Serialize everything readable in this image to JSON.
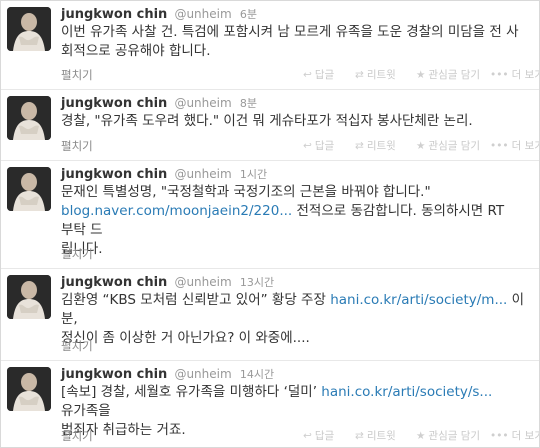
{
  "tweets": [
    {
      "name": "jungkwon chin",
      "handle": "@unheim",
      "time": "6분",
      "lines": [
        "이번 유가족 사찰 건. 특검에 포함시켜 남 모르게 유족을 도운 경찰의 미담을 전 사",
        "회적으로 공유해야 합니다."
      ],
      "expand": "펼치기"
    },
    {
      "name": "jungkwon chin",
      "handle": "@unheim",
      "time": "8분",
      "lines": [
        "경찰, \"유가족 도우려 했다.\" 이건 뭐 게슈타포가 적십자 봉사단체란 논리."
      ],
      "expand": "펼치기"
    },
    {
      "name": "jungkwon chin",
      "handle": "@unheim",
      "time": "1시간",
      "line1": "문재인 특별성명, \"국정철학과 국정기조의 근본을 바꿔야 합니다.\"",
      "link": "blog.naver.com/moonjaein2/220...",
      "line2_rest": " 전적으로 동감합니다. 동의하시면 RT 부탁 드",
      "line3": "립니다.",
      "expand": "펼치기"
    },
    {
      "name": "jungkwon chin",
      "handle": "@unheim",
      "time": "13시간",
      "line1_pre": "김환영 “KBS 모처럼 신뢰받고 있어” 황당 주장 ",
      "link": "hani.co.kr/arti/society/m...",
      "line1_post": " 이 분,",
      "line2": "정신이 좀 이상한 거 아닌가요? 이 와중에....",
      "expand": "펼치기"
    },
    {
      "name": "jungkwon chin",
      "handle": "@unheim",
      "time": "14시간",
      "line1_pre": "[속보] 경찰, 세월호 유가족을 미행하다 ‘덜미’ ",
      "link": "hani.co.kr/arti/society/s...",
      "line1_post": " 유가족을",
      "line2": "범죄자 취급하는 거죠.",
      "expand": "펼치기"
    }
  ],
  "actions": {
    "reply": "답글",
    "retweet": "리트윗",
    "favorite": "관심글 담기",
    "more": "더 보기",
    "reply_icon": "reply-arrow-icon",
    "retweet_icon": "retweet-arrows-icon",
    "favorite_icon": "star-icon",
    "more_icon": "ellipsis-icon"
  },
  "colors": {
    "link": "#2a7bb5",
    "muted": "#999999",
    "text": "#333333"
  }
}
